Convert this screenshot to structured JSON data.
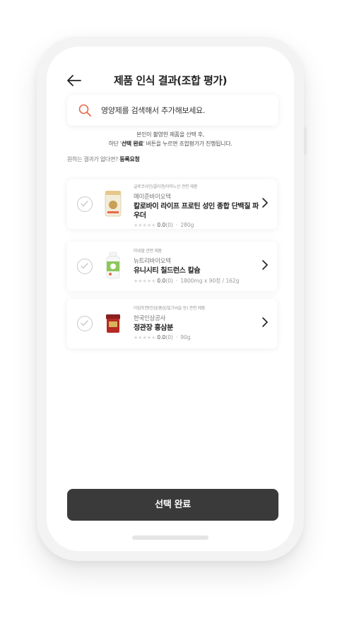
{
  "header": {
    "title": "제품 인식 결과(조합 평가)"
  },
  "search": {
    "text": "영양제를 검색해서 추가해보세요."
  },
  "guide": {
    "line1": "본인이 촬영한 제품을 선택 후,",
    "line2_prefix": "하단 '",
    "line2_bold": "선택 완료",
    "line2_suffix": "' 버튼을 누르면 조합평가가 진행됩니다."
  },
  "noresult": {
    "text": "원하는 결과가 없다면?",
    "link": "등록요청"
  },
  "products": [
    {
      "tag": "글루코사민/콜라겐/아미노산 관련 제품",
      "brand": "메이준바이오텍",
      "name": "칼로바이 라이프 프로틴 성인 종합 단백질 파우더",
      "score": "0.0",
      "reviews": "(0)",
      "spec": "280g"
    },
    {
      "tag": "미네랄 관련 제품",
      "brand": "뉴트리바이오텍",
      "name": "유니시티 칠드런스 칼슘",
      "score": "0.0",
      "reviews": "(0)",
      "spec": "1800mg x 90정 / 162g"
    },
    {
      "tag": "아답토젠(인삼/홍삼/밀크씨슬 등) 관련 제품",
      "brand": "한국인삼공사",
      "name": "정관장 홍삼분",
      "score": "0.0",
      "reviews": "(0)",
      "spec": "90g"
    }
  ],
  "footer": {
    "button_label": "선택 완료"
  },
  "colors": {
    "accent": "#e8684a",
    "button": "#3a3a3a"
  }
}
